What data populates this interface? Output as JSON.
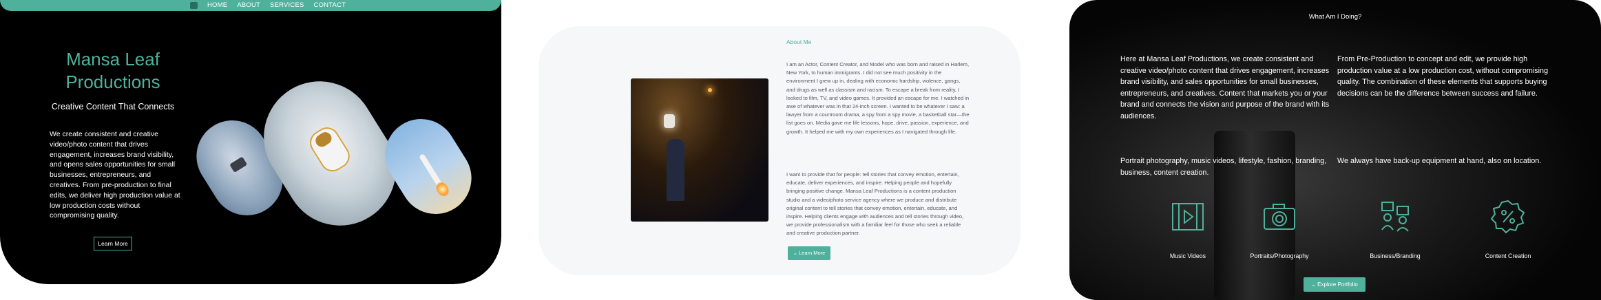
{
  "home": {
    "nav": [
      "HOME",
      "ABOUT",
      "SERVICES",
      "CONTACT"
    ],
    "title": "Mansa Leaf Productions",
    "tagline": "Creative Content That Connects",
    "body": "We create consistent and creative video/photo content that drives engagement, increases brand visibility, and opens sales opportunities for small businesses, entrepreneurs, and creatives. From pre-production to final edits, we deliver high production value at low production costs without compromising quality.",
    "button": "Learn More"
  },
  "about": {
    "heading": "About Me",
    "para1": "I am an Actor, Content Creator, and Model who was born and raised in Harlem, New York, to human immigrants. I did not see much positivity in the environment I grew up in, dealing with economic hardship, violence, gangs, and drugs as well as classism and racism. To escape a break from reality, I looked to film, TV, and video games. It provided an escape for me. I watched in awe of whatever was in that 24-inch screen. I wanted to be whatever I saw: a lawyer from a courtroom drama, a spy from a spy movie, a basketball star—the list goes on. Media gave me life lessons, hope, drive, passion, experience, and growth. It helped me with my own experiences as I navigated through life.",
    "para2": "I want to provide that for people: tell stories that convey emotion, entertain, educate, deliver experiences, and inspire. Helping people and hopefully bringing positive change. Mansa Leaf Productions is a content production studio and a video/photo service agency where we produce and distribute original content to tell stories that convey emotion, entertain, educate, and inspire. Helping clients engage with audiences and tell stories through video, we provide professionalism with a familiar feel for those who seek a reliable and creative production partner.",
    "button": "Learn More"
  },
  "services": {
    "heading": "What Am I Doing?",
    "text1": "Here at Mansa Leaf Productions, we create consistent and creative video/photo content that drives engagement, increases brand visibility, and sales opportunities for small businesses, entrepreneurs, and creatives. Content that markets you or your brand and connects the vision and purpose of the brand with its audiences.",
    "text2": "From Pre-Production to concept and edit, we provide high production value at a low production cost, without compromising quality. The combination of these elements that supports buying decisions can be the difference between success and failure.",
    "text3": "Portrait photography, music videos, lifestyle, fashion, branding, business, content creation.",
    "text4": "We always have back-up equipment at hand, also on location.",
    "items": [
      {
        "label": "Music Videos",
        "icon": "film-icon"
      },
      {
        "label": "Portraits/Photography",
        "icon": "camera-icon"
      },
      {
        "label": "Business/Branding",
        "icon": "meeting-icon"
      },
      {
        "label": "Content Creation",
        "icon": "percent-badge-icon"
      }
    ],
    "button": "Explore Portfolio"
  },
  "colors": {
    "accent": "#4fb19b",
    "dark": "#000000",
    "light": "#f5f7f8"
  }
}
